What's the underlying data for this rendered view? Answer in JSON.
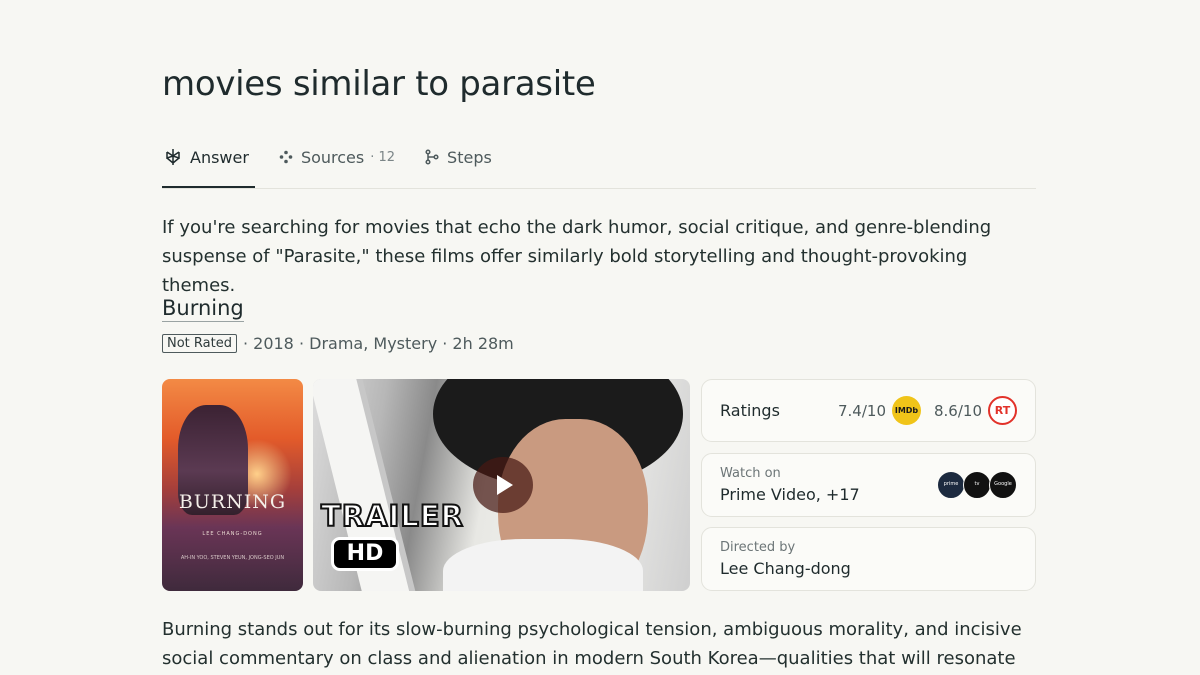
{
  "query": "movies similar to parasite",
  "tabs": [
    {
      "label": "Answer",
      "icon": "perplexity-icon"
    },
    {
      "label": "Sources",
      "count": "· 12",
      "icon": "sources-icon"
    },
    {
      "label": "Steps",
      "icon": "steps-icon"
    }
  ],
  "intro": "If you're searching for movies that echo the dark humor, social critique, and genre-blending suspense of \"Parasite,\" these films offer similarly bold storytelling and thought-provoking themes.",
  "movie": {
    "title": "Burning",
    "rating_badge": "Not Rated",
    "meta": "· 2018 · Drama, Mystery · 2h 28m",
    "poster": {
      "title": "BURNING",
      "credit": "LEE CHANG-DONG",
      "cast": "AH-IN YOO, STEVEN YEUN, JONG-SEO JUN"
    },
    "trailer": {
      "word": "TRAILER",
      "hd": "HD"
    },
    "ratings": {
      "label": "Ratings",
      "imdb_score": "7.4/10",
      "imdb_logo": "IMDb",
      "rt_score": "8.6/10",
      "rt_logo": "RT"
    },
    "watch": {
      "label": "Watch on",
      "value": "Prime Video, +17",
      "providers": [
        "prime video",
        "tv",
        "Google Play"
      ]
    },
    "director": {
      "label": "Directed by",
      "value": "Lee Chang-dong"
    }
  },
  "conclusion": "Burning stands out for its slow-burning psychological tension, ambiguous morality, and incisive social commentary on class and alienation in modern South Korea—qualities that will resonate with",
  "colors": {
    "background": "#f7f7f3",
    "text": "#1f2b2d",
    "imdb": "#f0c419",
    "rt": "#e2322a"
  }
}
